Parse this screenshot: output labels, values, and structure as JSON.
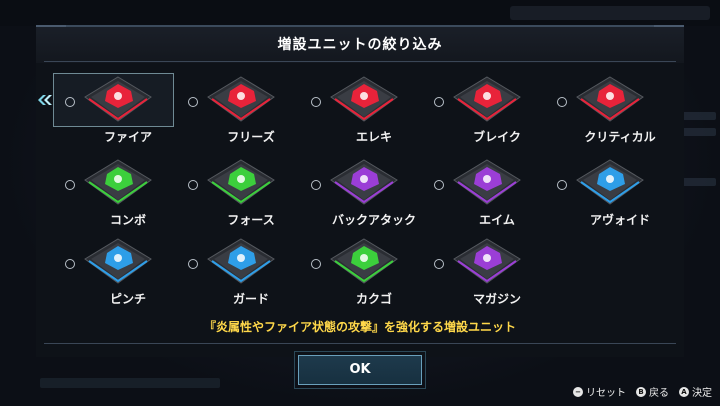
{
  "dialog": {
    "title": "増設ユニットの絞り込み",
    "description": "『炎属性やファイア状態の攻撃』を強化する増設ユニット",
    "ok_label": "OK",
    "selected_item": "ファイア"
  },
  "units": [
    {
      "label": "ファイア",
      "color": "#e8233a"
    },
    {
      "label": "フリーズ",
      "color": "#e8233a"
    },
    {
      "label": "エレキ",
      "color": "#e8233a"
    },
    {
      "label": "ブレイク",
      "color": "#e8233a"
    },
    {
      "label": "クリティカル",
      "color": "#e8233a"
    },
    {
      "label": "コンボ",
      "color": "#3ccf3c"
    },
    {
      "label": "フォース",
      "color": "#3ccf3c"
    },
    {
      "label": "バックアタック",
      "color": "#9b3ed6"
    },
    {
      "label": "エイム",
      "color": "#9b3ed6"
    },
    {
      "label": "アヴォイド",
      "color": "#2e9ee8"
    },
    {
      "label": "ピンチ",
      "color": "#2e9ee8"
    },
    {
      "label": "ガード",
      "color": "#2e9ee8"
    },
    {
      "label": "カクゴ",
      "color": "#3ccf3c"
    },
    {
      "label": "マガジン",
      "color": "#9b3ed6"
    }
  ],
  "footer": {
    "reset_glyph": "−",
    "reset_label": "リセット",
    "back_glyph": "B",
    "back_label": "戻る",
    "confirm_glyph": "A",
    "confirm_label": "決定"
  },
  "icons": {
    "selection_arrow": "selection-arrow-icon",
    "unit_chip": "unit-chip-icon"
  }
}
